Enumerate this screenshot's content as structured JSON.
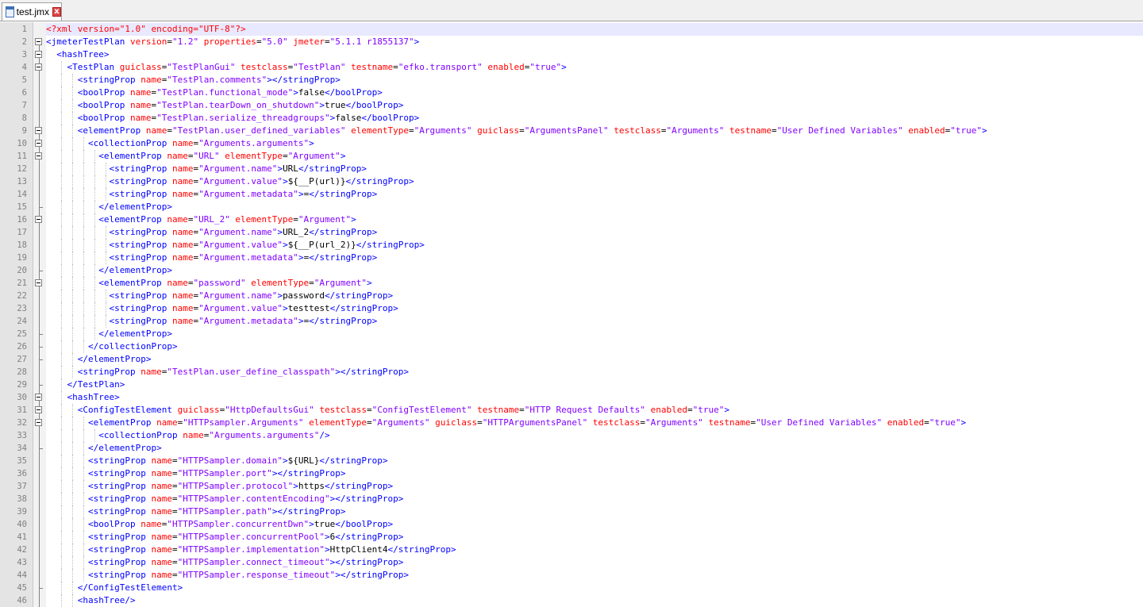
{
  "tab": {
    "title": "test.jmx",
    "close_label": "x",
    "icon": "xml-file-icon"
  },
  "colors": {
    "tag": "#0000ff",
    "attr": "#ff0000",
    "value": "#8000ff",
    "text": "#000000",
    "current_line": "#e8e8ff"
  },
  "lines": [
    [
      [
        "p",
        "<?xml version=\"1.0\" encoding=\"UTF-8\"?>"
      ]
    ],
    [
      [
        "t",
        "<jmeterTestPlan "
      ],
      [
        "a",
        "version"
      ],
      [
        "x",
        "="
      ],
      [
        "v",
        "\"1.2\""
      ],
      [
        "a",
        " properties"
      ],
      [
        "x",
        "="
      ],
      [
        "v",
        "\"5.0\""
      ],
      [
        "a",
        " jmeter"
      ],
      [
        "x",
        "="
      ],
      [
        "v",
        "\"5.1.1 r1855137\""
      ],
      [
        "t",
        ">"
      ]
    ],
    [
      [
        "x",
        "  "
      ],
      [
        "t",
        "<hashTree>"
      ]
    ],
    [
      [
        "x",
        "    "
      ],
      [
        "t",
        "<TestPlan "
      ],
      [
        "a",
        "guiclass"
      ],
      [
        "x",
        "="
      ],
      [
        "v",
        "\"TestPlanGui\""
      ],
      [
        "a",
        " testclass"
      ],
      [
        "x",
        "="
      ],
      [
        "v",
        "\"TestPlan\""
      ],
      [
        "a",
        " testname"
      ],
      [
        "x",
        "="
      ],
      [
        "v",
        "\"efko.transport\""
      ],
      [
        "a",
        " enabled"
      ],
      [
        "x",
        "="
      ],
      [
        "v",
        "\"true\""
      ],
      [
        "t",
        ">"
      ]
    ],
    [
      [
        "x",
        "      "
      ],
      [
        "t",
        "<stringProp "
      ],
      [
        "a",
        "name"
      ],
      [
        "x",
        "="
      ],
      [
        "v",
        "\"TestPlan.comments\""
      ],
      [
        "t",
        "></stringProp>"
      ]
    ],
    [
      [
        "x",
        "      "
      ],
      [
        "t",
        "<boolProp "
      ],
      [
        "a",
        "name"
      ],
      [
        "x",
        "="
      ],
      [
        "v",
        "\"TestPlan.functional_mode\""
      ],
      [
        "t",
        ">"
      ],
      [
        "x",
        "false"
      ],
      [
        "t",
        "</boolProp>"
      ]
    ],
    [
      [
        "x",
        "      "
      ],
      [
        "t",
        "<boolProp "
      ],
      [
        "a",
        "name"
      ],
      [
        "x",
        "="
      ],
      [
        "v",
        "\"TestPlan.tearDown_on_shutdown\""
      ],
      [
        "t",
        ">"
      ],
      [
        "x",
        "true"
      ],
      [
        "t",
        "</boolProp>"
      ]
    ],
    [
      [
        "x",
        "      "
      ],
      [
        "t",
        "<boolProp "
      ],
      [
        "a",
        "name"
      ],
      [
        "x",
        "="
      ],
      [
        "v",
        "\"TestPlan.serialize_threadgroups\""
      ],
      [
        "t",
        ">"
      ],
      [
        "x",
        "false"
      ],
      [
        "t",
        "</boolProp>"
      ]
    ],
    [
      [
        "x",
        "      "
      ],
      [
        "t",
        "<elementProp "
      ],
      [
        "a",
        "name"
      ],
      [
        "x",
        "="
      ],
      [
        "v",
        "\"TestPlan.user_defined_variables\""
      ],
      [
        "a",
        " elementType"
      ],
      [
        "x",
        "="
      ],
      [
        "v",
        "\"Arguments\""
      ],
      [
        "a",
        " guiclass"
      ],
      [
        "x",
        "="
      ],
      [
        "v",
        "\"ArgumentsPanel\""
      ],
      [
        "a",
        " testclass"
      ],
      [
        "x",
        "="
      ],
      [
        "v",
        "\"Arguments\""
      ],
      [
        "a",
        " testname"
      ],
      [
        "x",
        "="
      ],
      [
        "v",
        "\"User Defined Variables\""
      ],
      [
        "a",
        " enabled"
      ],
      [
        "x",
        "="
      ],
      [
        "v",
        "\"true\""
      ],
      [
        "t",
        ">"
      ]
    ],
    [
      [
        "x",
        "        "
      ],
      [
        "t",
        "<collectionProp "
      ],
      [
        "a",
        "name"
      ],
      [
        "x",
        "="
      ],
      [
        "v",
        "\"Arguments.arguments\""
      ],
      [
        "t",
        ">"
      ]
    ],
    [
      [
        "x",
        "          "
      ],
      [
        "t",
        "<elementProp "
      ],
      [
        "a",
        "name"
      ],
      [
        "x",
        "="
      ],
      [
        "v",
        "\"URL\""
      ],
      [
        "a",
        " elementType"
      ],
      [
        "x",
        "="
      ],
      [
        "v",
        "\"Argument\""
      ],
      [
        "t",
        ">"
      ]
    ],
    [
      [
        "x",
        "            "
      ],
      [
        "t",
        "<stringProp "
      ],
      [
        "a",
        "name"
      ],
      [
        "x",
        "="
      ],
      [
        "v",
        "\"Argument.name\""
      ],
      [
        "t",
        ">"
      ],
      [
        "x",
        "URL"
      ],
      [
        "t",
        "</stringProp>"
      ]
    ],
    [
      [
        "x",
        "            "
      ],
      [
        "t",
        "<stringProp "
      ],
      [
        "a",
        "name"
      ],
      [
        "x",
        "="
      ],
      [
        "v",
        "\"Argument.value\""
      ],
      [
        "t",
        ">"
      ],
      [
        "x",
        "${__P(url)}"
      ],
      [
        "t",
        "</stringProp>"
      ]
    ],
    [
      [
        "x",
        "            "
      ],
      [
        "t",
        "<stringProp "
      ],
      [
        "a",
        "name"
      ],
      [
        "x",
        "="
      ],
      [
        "v",
        "\"Argument.metadata\""
      ],
      [
        "t",
        ">"
      ],
      [
        "x",
        "="
      ],
      [
        "t",
        "</stringProp>"
      ]
    ],
    [
      [
        "x",
        "          "
      ],
      [
        "t",
        "</elementProp>"
      ]
    ],
    [
      [
        "x",
        "          "
      ],
      [
        "t",
        "<elementProp "
      ],
      [
        "a",
        "name"
      ],
      [
        "x",
        "="
      ],
      [
        "v",
        "\"URL_2\""
      ],
      [
        "a",
        " elementType"
      ],
      [
        "x",
        "="
      ],
      [
        "v",
        "\"Argument\""
      ],
      [
        "t",
        ">"
      ]
    ],
    [
      [
        "x",
        "            "
      ],
      [
        "t",
        "<stringProp "
      ],
      [
        "a",
        "name"
      ],
      [
        "x",
        "="
      ],
      [
        "v",
        "\"Argument.name\""
      ],
      [
        "t",
        ">"
      ],
      [
        "x",
        "URL_2"
      ],
      [
        "t",
        "</stringProp>"
      ]
    ],
    [
      [
        "x",
        "            "
      ],
      [
        "t",
        "<stringProp "
      ],
      [
        "a",
        "name"
      ],
      [
        "x",
        "="
      ],
      [
        "v",
        "\"Argument.value\""
      ],
      [
        "t",
        ">"
      ],
      [
        "x",
        "${__P(url_2)}"
      ],
      [
        "t",
        "</stringProp>"
      ]
    ],
    [
      [
        "x",
        "            "
      ],
      [
        "t",
        "<stringProp "
      ],
      [
        "a",
        "name"
      ],
      [
        "x",
        "="
      ],
      [
        "v",
        "\"Argument.metadata\""
      ],
      [
        "t",
        ">"
      ],
      [
        "x",
        "="
      ],
      [
        "t",
        "</stringProp>"
      ]
    ],
    [
      [
        "x",
        "          "
      ],
      [
        "t",
        "</elementProp>"
      ]
    ],
    [
      [
        "x",
        "          "
      ],
      [
        "t",
        "<elementProp "
      ],
      [
        "a",
        "name"
      ],
      [
        "x",
        "="
      ],
      [
        "v",
        "\"password\""
      ],
      [
        "a",
        " elementType"
      ],
      [
        "x",
        "="
      ],
      [
        "v",
        "\"Argument\""
      ],
      [
        "t",
        ">"
      ]
    ],
    [
      [
        "x",
        "            "
      ],
      [
        "t",
        "<stringProp "
      ],
      [
        "a",
        "name"
      ],
      [
        "x",
        "="
      ],
      [
        "v",
        "\"Argument.name\""
      ],
      [
        "t",
        ">"
      ],
      [
        "x",
        "password"
      ],
      [
        "t",
        "</stringProp>"
      ]
    ],
    [
      [
        "x",
        "            "
      ],
      [
        "t",
        "<stringProp "
      ],
      [
        "a",
        "name"
      ],
      [
        "x",
        "="
      ],
      [
        "v",
        "\"Argument.value\""
      ],
      [
        "t",
        ">"
      ],
      [
        "x",
        "testtest"
      ],
      [
        "t",
        "</stringProp>"
      ]
    ],
    [
      [
        "x",
        "            "
      ],
      [
        "t",
        "<stringProp "
      ],
      [
        "a",
        "name"
      ],
      [
        "x",
        "="
      ],
      [
        "v",
        "\"Argument.metadata\""
      ],
      [
        "t",
        ">"
      ],
      [
        "x",
        "="
      ],
      [
        "t",
        "</stringProp>"
      ]
    ],
    [
      [
        "x",
        "          "
      ],
      [
        "t",
        "</elementProp>"
      ]
    ],
    [
      [
        "x",
        "        "
      ],
      [
        "t",
        "</collectionProp>"
      ]
    ],
    [
      [
        "x",
        "      "
      ],
      [
        "t",
        "</elementProp>"
      ]
    ],
    [
      [
        "x",
        "      "
      ],
      [
        "t",
        "<stringProp "
      ],
      [
        "a",
        "name"
      ],
      [
        "x",
        "="
      ],
      [
        "v",
        "\"TestPlan.user_define_classpath\""
      ],
      [
        "t",
        "></stringProp>"
      ]
    ],
    [
      [
        "x",
        "    "
      ],
      [
        "t",
        "</TestPlan>"
      ]
    ],
    [
      [
        "x",
        "    "
      ],
      [
        "t",
        "<hashTree>"
      ]
    ],
    [
      [
        "x",
        "      "
      ],
      [
        "t",
        "<ConfigTestElement "
      ],
      [
        "a",
        "guiclass"
      ],
      [
        "x",
        "="
      ],
      [
        "v",
        "\"HttpDefaultsGui\""
      ],
      [
        "a",
        " testclass"
      ],
      [
        "x",
        "="
      ],
      [
        "v",
        "\"ConfigTestElement\""
      ],
      [
        "a",
        " testname"
      ],
      [
        "x",
        "="
      ],
      [
        "v",
        "\"HTTP Request Defaults\""
      ],
      [
        "a",
        " enabled"
      ],
      [
        "x",
        "="
      ],
      [
        "v",
        "\"true\""
      ],
      [
        "t",
        ">"
      ]
    ],
    [
      [
        "x",
        "        "
      ],
      [
        "t",
        "<elementProp "
      ],
      [
        "a",
        "name"
      ],
      [
        "x",
        "="
      ],
      [
        "v",
        "\"HTTPsampler.Arguments\""
      ],
      [
        "a",
        " elementType"
      ],
      [
        "x",
        "="
      ],
      [
        "v",
        "\"Arguments\""
      ],
      [
        "a",
        " guiclass"
      ],
      [
        "x",
        "="
      ],
      [
        "v",
        "\"HTTPArgumentsPanel\""
      ],
      [
        "a",
        " testclass"
      ],
      [
        "x",
        "="
      ],
      [
        "v",
        "\"Arguments\""
      ],
      [
        "a",
        " testname"
      ],
      [
        "x",
        "="
      ],
      [
        "v",
        "\"User Defined Variables\""
      ],
      [
        "a",
        " enabled"
      ],
      [
        "x",
        "="
      ],
      [
        "v",
        "\"true\""
      ],
      [
        "t",
        ">"
      ]
    ],
    [
      [
        "x",
        "          "
      ],
      [
        "t",
        "<collectionProp "
      ],
      [
        "a",
        "name"
      ],
      [
        "x",
        "="
      ],
      [
        "v",
        "\"Arguments.arguments\""
      ],
      [
        "t",
        "/>"
      ]
    ],
    [
      [
        "x",
        "        "
      ],
      [
        "t",
        "</elementProp>"
      ]
    ],
    [
      [
        "x",
        "        "
      ],
      [
        "t",
        "<stringProp "
      ],
      [
        "a",
        "name"
      ],
      [
        "x",
        "="
      ],
      [
        "v",
        "\"HTTPSampler.domain\""
      ],
      [
        "t",
        ">"
      ],
      [
        "x",
        "${URL}"
      ],
      [
        "t",
        "</stringProp>"
      ]
    ],
    [
      [
        "x",
        "        "
      ],
      [
        "t",
        "<stringProp "
      ],
      [
        "a",
        "name"
      ],
      [
        "x",
        "="
      ],
      [
        "v",
        "\"HTTPSampler.port\""
      ],
      [
        "t",
        "></stringProp>"
      ]
    ],
    [
      [
        "x",
        "        "
      ],
      [
        "t",
        "<stringProp "
      ],
      [
        "a",
        "name"
      ],
      [
        "x",
        "="
      ],
      [
        "v",
        "\"HTTPSampler.protocol\""
      ],
      [
        "t",
        ">"
      ],
      [
        "x",
        "https"
      ],
      [
        "t",
        "</stringProp>"
      ]
    ],
    [
      [
        "x",
        "        "
      ],
      [
        "t",
        "<stringProp "
      ],
      [
        "a",
        "name"
      ],
      [
        "x",
        "="
      ],
      [
        "v",
        "\"HTTPSampler.contentEncoding\""
      ],
      [
        "t",
        "></stringProp>"
      ]
    ],
    [
      [
        "x",
        "        "
      ],
      [
        "t",
        "<stringProp "
      ],
      [
        "a",
        "name"
      ],
      [
        "x",
        "="
      ],
      [
        "v",
        "\"HTTPSampler.path\""
      ],
      [
        "t",
        "></stringProp>"
      ]
    ],
    [
      [
        "x",
        "        "
      ],
      [
        "t",
        "<boolProp "
      ],
      [
        "a",
        "name"
      ],
      [
        "x",
        "="
      ],
      [
        "v",
        "\"HTTPSampler.concurrentDwn\""
      ],
      [
        "t",
        ">"
      ],
      [
        "x",
        "true"
      ],
      [
        "t",
        "</boolProp>"
      ]
    ],
    [
      [
        "x",
        "        "
      ],
      [
        "t",
        "<stringProp "
      ],
      [
        "a",
        "name"
      ],
      [
        "x",
        "="
      ],
      [
        "v",
        "\"HTTPSampler.concurrentPool\""
      ],
      [
        "t",
        ">"
      ],
      [
        "x",
        "6"
      ],
      [
        "t",
        "</stringProp>"
      ]
    ],
    [
      [
        "x",
        "        "
      ],
      [
        "t",
        "<stringProp "
      ],
      [
        "a",
        "name"
      ],
      [
        "x",
        "="
      ],
      [
        "v",
        "\"HTTPSampler.implementation\""
      ],
      [
        "t",
        ">"
      ],
      [
        "x",
        "HttpClient4"
      ],
      [
        "t",
        "</stringProp>"
      ]
    ],
    [
      [
        "x",
        "        "
      ],
      [
        "t",
        "<stringProp "
      ],
      [
        "a",
        "name"
      ],
      [
        "x",
        "="
      ],
      [
        "v",
        "\"HTTPSampler.connect_timeout\""
      ],
      [
        "t",
        "></stringProp>"
      ]
    ],
    [
      [
        "x",
        "        "
      ],
      [
        "t",
        "<stringProp "
      ],
      [
        "a",
        "name"
      ],
      [
        "x",
        "="
      ],
      [
        "v",
        "\"HTTPSampler.response_timeout\""
      ],
      [
        "t",
        "></stringProp>"
      ]
    ],
    [
      [
        "x",
        "      "
      ],
      [
        "t",
        "</ConfigTestElement>"
      ]
    ],
    [
      [
        "x",
        "      "
      ],
      [
        "t",
        "<hashTree/>"
      ]
    ]
  ]
}
